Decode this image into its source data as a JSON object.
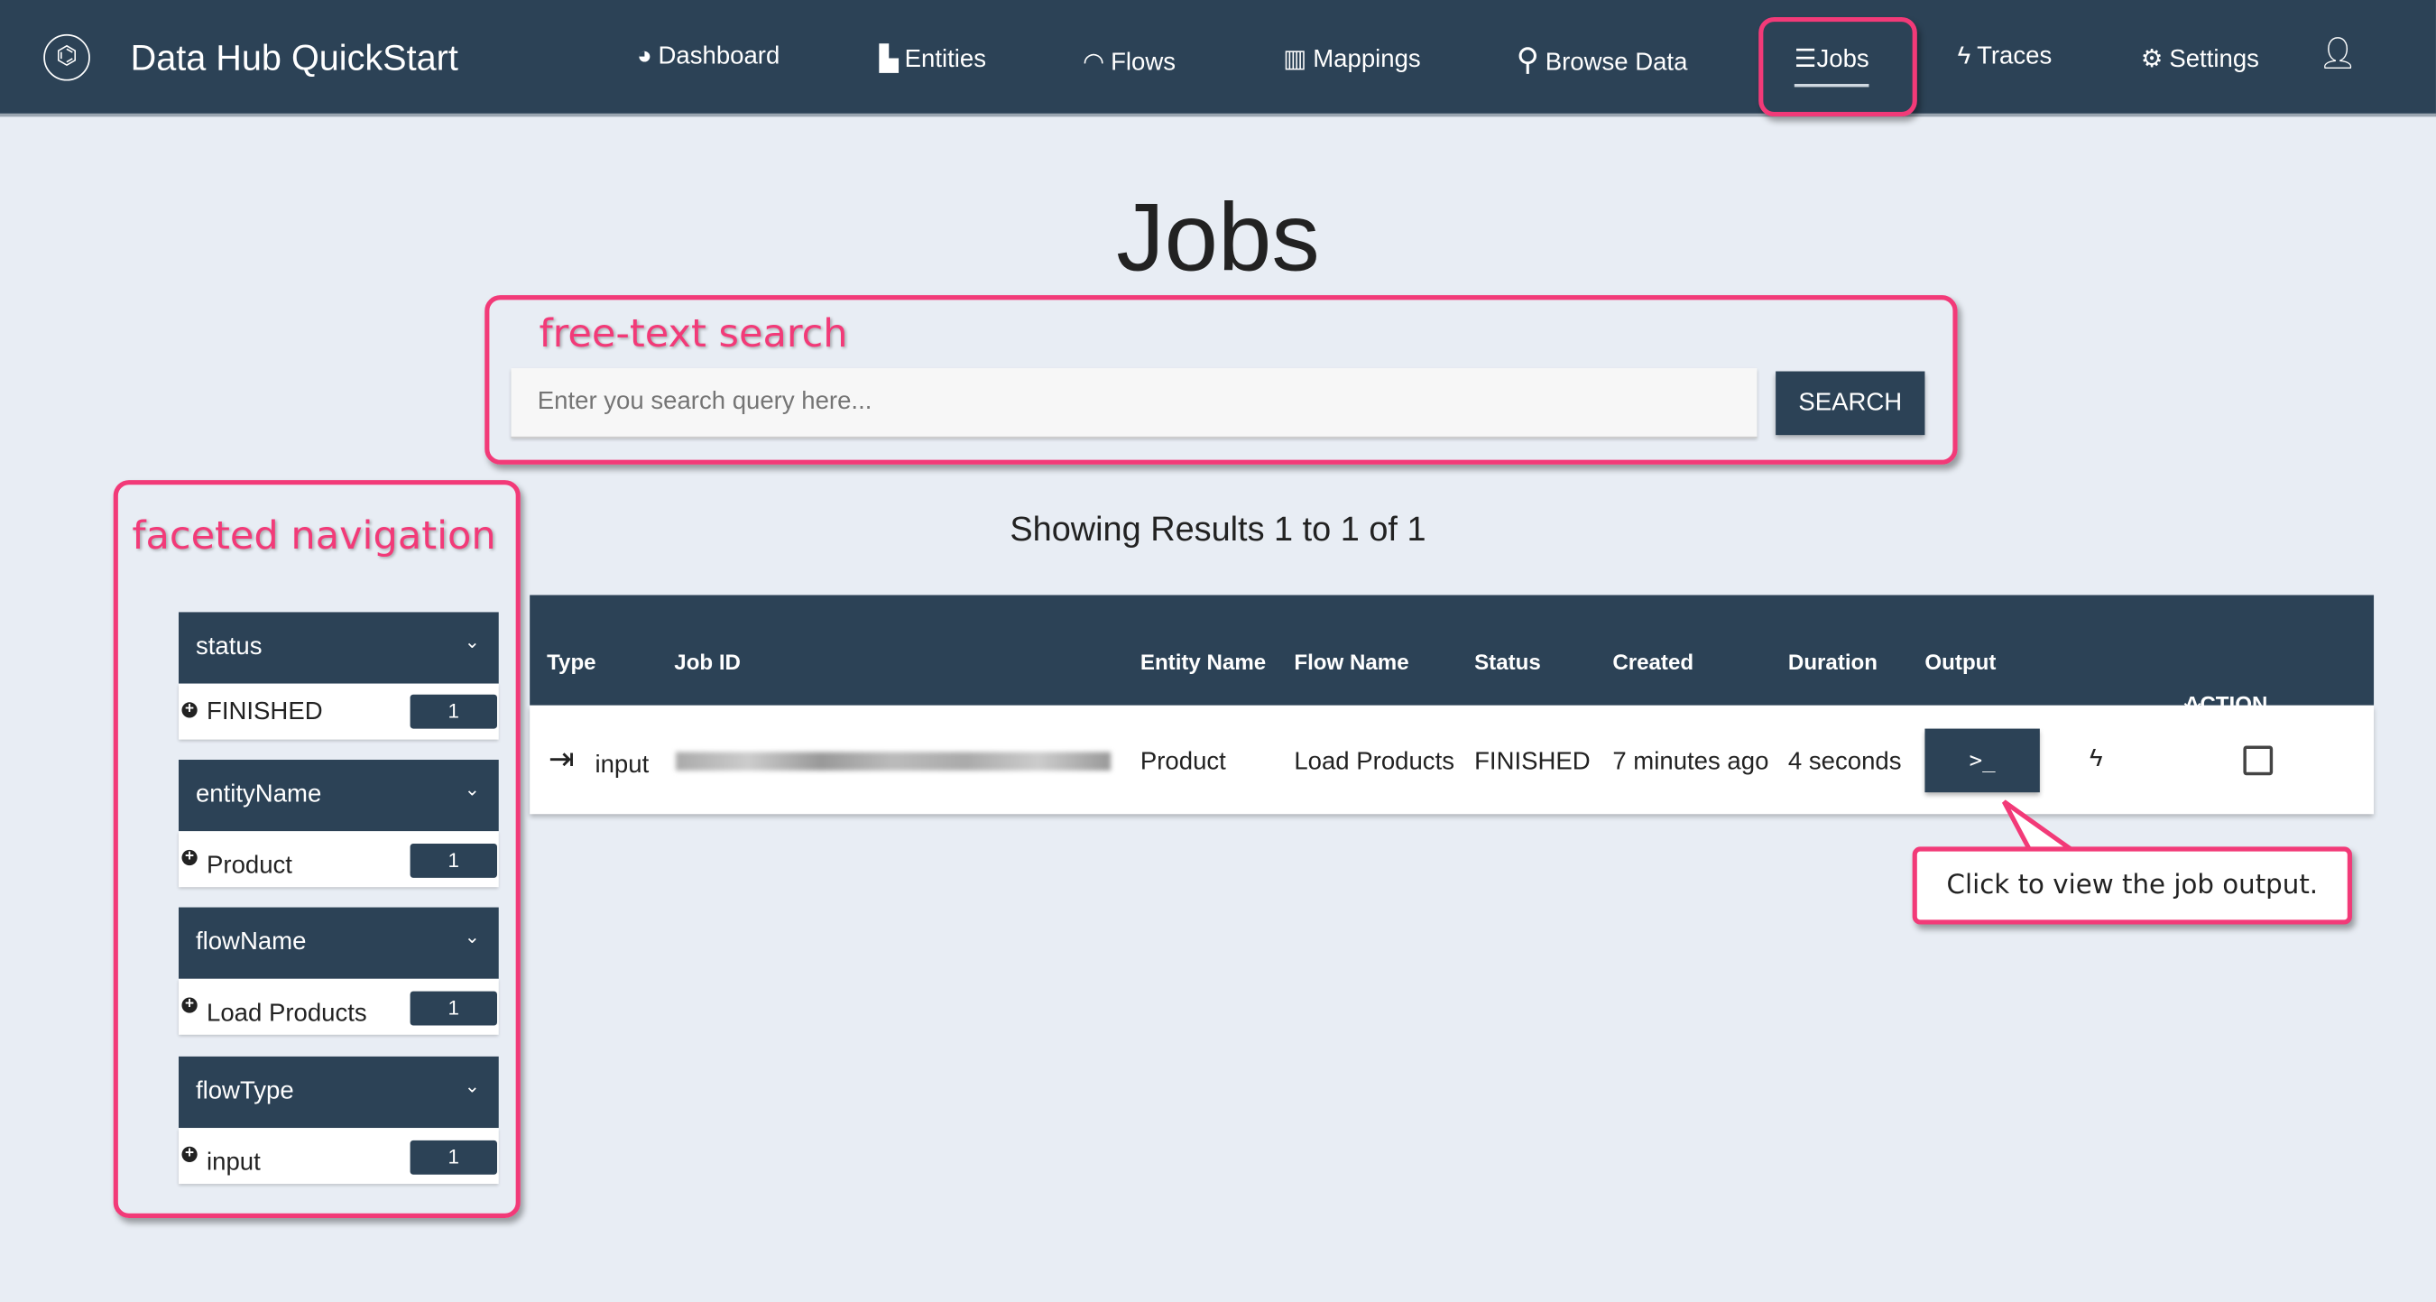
{
  "nav": {
    "brand": "Data Hub QuickStart",
    "items": [
      {
        "label": "Dashboard",
        "icon": "dashboard-icon"
      },
      {
        "label": "Entities",
        "icon": "entities-icon"
      },
      {
        "label": "Flows",
        "icon": "flows-icon"
      },
      {
        "label": "Mappings",
        "icon": "map-icon"
      },
      {
        "label": "Browse Data",
        "icon": "search-icon"
      },
      {
        "label": "Jobs",
        "icon": "list-icon",
        "active": true
      },
      {
        "label": "Traces",
        "icon": "bolt-icon"
      },
      {
        "label": "Settings",
        "icon": "gear-icon"
      }
    ]
  },
  "page": {
    "title": "Jobs",
    "search_placeholder": "Enter you search query here...",
    "search_button": "SEARCH",
    "results": "Showing Results 1 to 1 of 1"
  },
  "annotations": {
    "search": "free-text search",
    "facets": "faceted navigation",
    "callout": "Click to view the job output.",
    "color": "#f23a78"
  },
  "facets": [
    {
      "name": "status",
      "value": "FINISHED",
      "count": "1"
    },
    {
      "name": "entityName",
      "value": "Product",
      "count": "1"
    },
    {
      "name": "flowName",
      "value": "Load Products",
      "count": "1"
    },
    {
      "name": "flowType",
      "value": "input",
      "count": "1"
    }
  ],
  "table": {
    "headers": [
      "Type",
      "Job ID",
      "Entity Name",
      "Flow Name",
      "Status",
      "Created",
      "Duration",
      "Output"
    ],
    "action": "ACTION",
    "rows": [
      {
        "type": "input",
        "entity": "Product",
        "flow": "Load Products",
        "status": "FINISHED",
        "created": "7 minutes ago",
        "duration": "4 seconds",
        "output_button": ">_"
      }
    ]
  }
}
